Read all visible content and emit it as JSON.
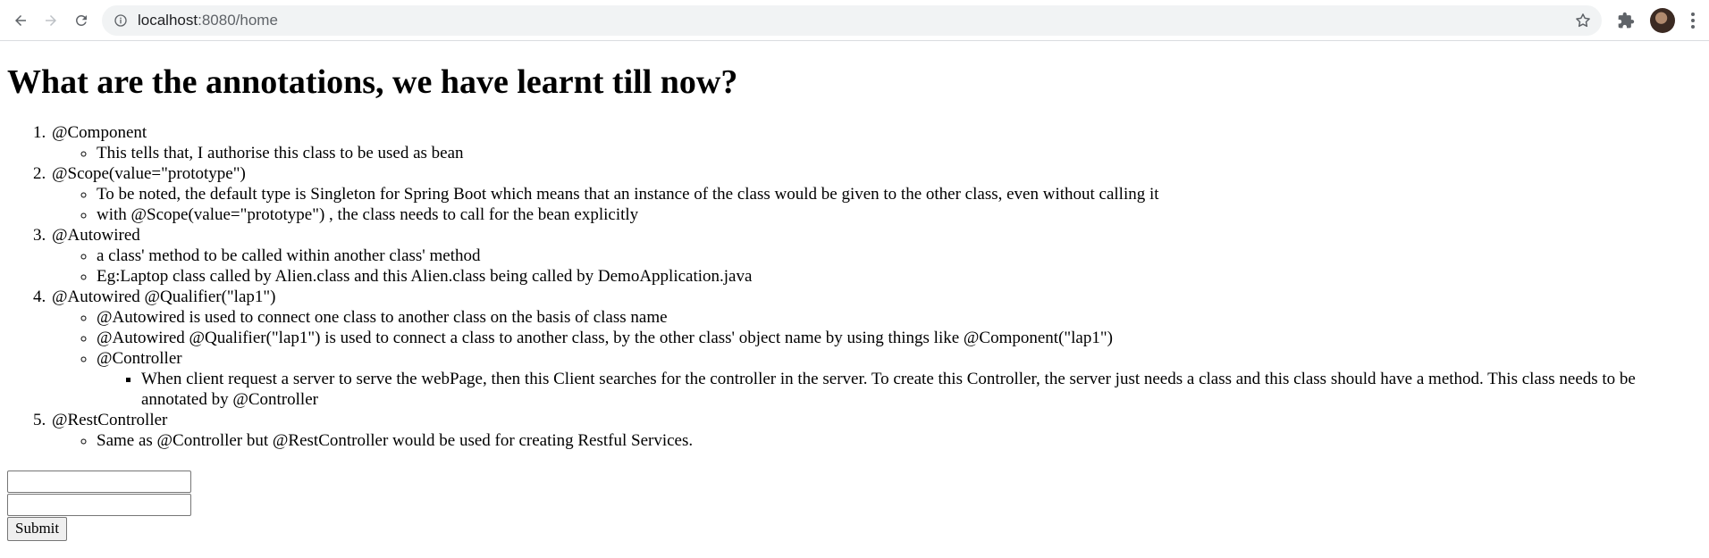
{
  "browser": {
    "url_host": "localhost",
    "url_path": ":8080/home",
    "icons": [
      "back-arrow-icon",
      "forward-arrow-icon",
      "reload-icon",
      "info-icon",
      "star-icon",
      "extensions-icon",
      "profile-avatar",
      "menu-icon"
    ]
  },
  "page": {
    "heading": "What are the annotations, we have learnt till now?",
    "items": [
      {
        "title": "@Component",
        "subs": [
          "This tells that, I authorise this class to be used as bean"
        ]
      },
      {
        "title": "@Scope(value=\"prototype\")",
        "subs": [
          "To be noted, the default type is Singleton for Spring Boot which means that an instance of the class would be given to the other class, even without calling it",
          "with @Scope(value=\"prototype\") , the class needs to call for the bean explicitly"
        ]
      },
      {
        "title": "@Autowired",
        "subs": [
          "a class' method to be called within another class' method",
          "Eg:Laptop class called by Alien.class and this Alien.class being called by DemoApplication.java"
        ]
      },
      {
        "title": "@Autowired @Qualifier(\"lap1\")",
        "subs": [
          "@Autowired is used to connect one class to another class on the basis of class name",
          "@Autowired @Qualifier(\"lap1\") is used to connect a class to another class, by the other class' object name by using things like @Component(\"lap1\")",
          "@Controller"
        ],
        "subsub": "When client request a server to serve the webPage, then this Client searches for the controller in the server. To create this Controller, the server just needs a class and this class should have a method. This class needs to be annotated by @Controller"
      },
      {
        "title": "@RestController",
        "subs": [
          "Same as @Controller but @RestController would be used for creating Restful Services."
        ]
      }
    ],
    "form": {
      "field1_value": "",
      "field2_value": "",
      "submit_label": "Submit"
    }
  }
}
